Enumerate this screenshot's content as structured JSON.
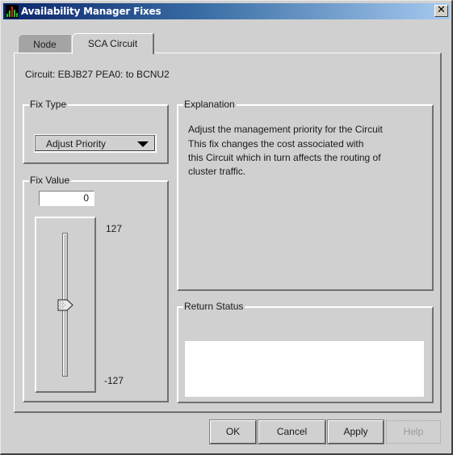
{
  "window": {
    "title": "Availability Manager Fixes",
    "close_label": "✕"
  },
  "tabs": [
    {
      "label": "Node",
      "selected": false
    },
    {
      "label": "SCA Circuit",
      "selected": true
    }
  ],
  "circuit_label": "Circuit: EBJB27 PEA0: to BCNU2",
  "fix_type": {
    "title": "Fix Type",
    "selected": "Adjust Priority"
  },
  "explanation": {
    "title": "Explanation",
    "lines": [
      "Adjust the management priority for the Circuit",
      "This fix changes the cost associated with",
      "this Circuit which in turn affects the routing of",
      "cluster traffic."
    ]
  },
  "fix_value": {
    "title": "Fix Value",
    "value": "0",
    "slider": {
      "min": -127,
      "max": 127,
      "current": 0,
      "min_label": "-127",
      "max_label": "127"
    }
  },
  "return_status": {
    "title": "Return Status",
    "text": ""
  },
  "buttons": {
    "ok": "OK",
    "cancel": "Cancel",
    "apply": "Apply",
    "help": "Help"
  },
  "colors": {
    "titlebar_start": "#0a246a",
    "titlebar_end": "#a6caf0",
    "dialog_bg": "#d0d0d0",
    "disabled_text": "#9a9a9a"
  }
}
